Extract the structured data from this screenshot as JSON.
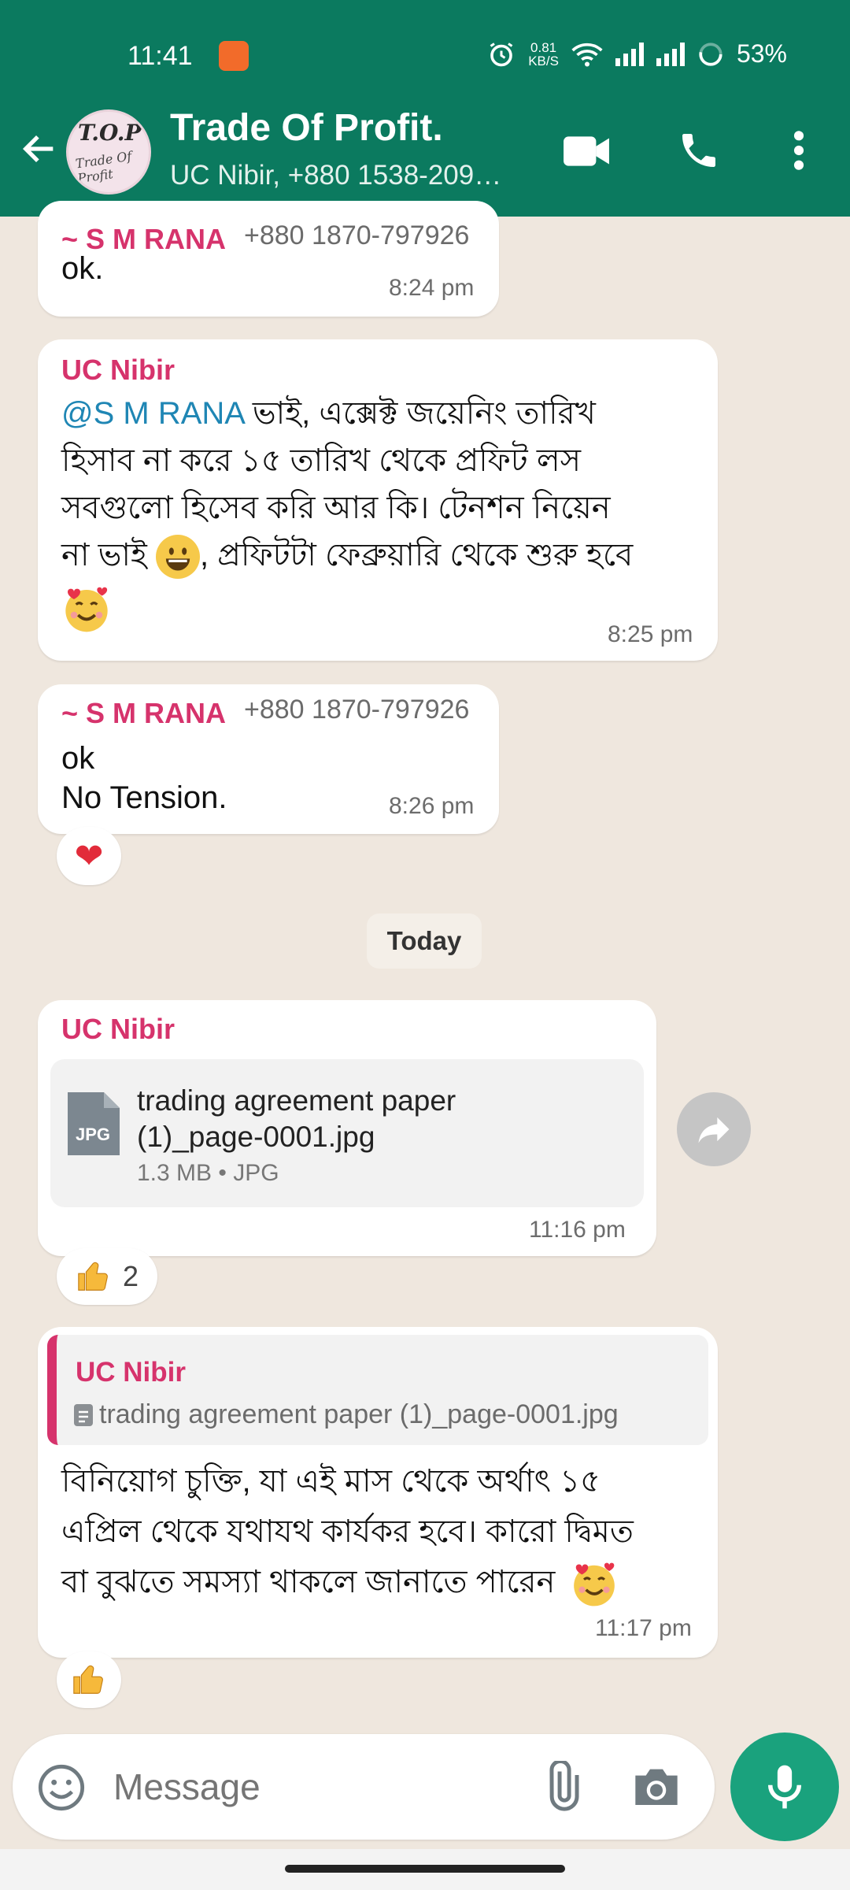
{
  "status_bar": {
    "time": "11:41",
    "net_speed": "0.81",
    "net_unit": "KB/S",
    "battery": "53%"
  },
  "header": {
    "title": "Trade Of Profit.",
    "subtitle": "UC Nibir, +880 1538-209…",
    "avatar_text": "T.O.P",
    "avatar_subtext": "Trade Of Profit",
    "colors": {
      "bar": "#0b7a5f"
    }
  },
  "messages": [
    {
      "sender": "~ S M RANA",
      "phone": "+880 1870-797926",
      "text": "ok.",
      "time": "8:24 pm"
    },
    {
      "sender": "UC Nibir",
      "mention": "@S M RANA",
      "line1_rest": " ভাই, এক্সেক্ট জয়েনিং তারিখ",
      "line2": "হিসাব না করে ১৫ তারিখ থেকে প্রফিট লস",
      "line3": "সবগুলো হিসেব করি আর কি। টেনশন নিয়েন",
      "line4_a": "না ভাই",
      "line4_b": ", প্রফিটটা ফেব্রুয়ারি থেকে শুরু হবে",
      "time": "8:25 pm"
    },
    {
      "sender": "~ S M RANA",
      "phone": "+880 1870-797926",
      "line1": "ok",
      "line2": "No Tension.",
      "time": "8:26 pm",
      "reaction": "❤"
    },
    {
      "sender": "UC Nibir",
      "doc_name_1": "trading agreement paper",
      "doc_name_2": "(1)_page-0001.jpg",
      "doc_meta": "1.3 MB • JPG",
      "doc_icon_label": "JPG",
      "time": "11:16 pm",
      "reaction_count": "2"
    },
    {
      "quote_sender": "UC Nibir",
      "quote_text": "trading agreement paper (1)_page-0001.jpg",
      "line1": "বিনিয়োগ চুক্তি, যা এই মাস থেকে অর্থাৎ ১৫",
      "line2": "এপ্রিল থেকে যথাযথ কার্যকর হবে। কারো দ্বিমত",
      "line3": "বা বুঝতে সমস্যা থাকলে জানাতে পারেন",
      "time": "11:17 pm"
    }
  ],
  "date_divider": "Today",
  "composer": {
    "placeholder": "Message"
  },
  "colors": {
    "accent": "#1aa27d",
    "sender": "#d6336c",
    "mention": "#1f86b4",
    "chat_bg": "#efe7de"
  }
}
